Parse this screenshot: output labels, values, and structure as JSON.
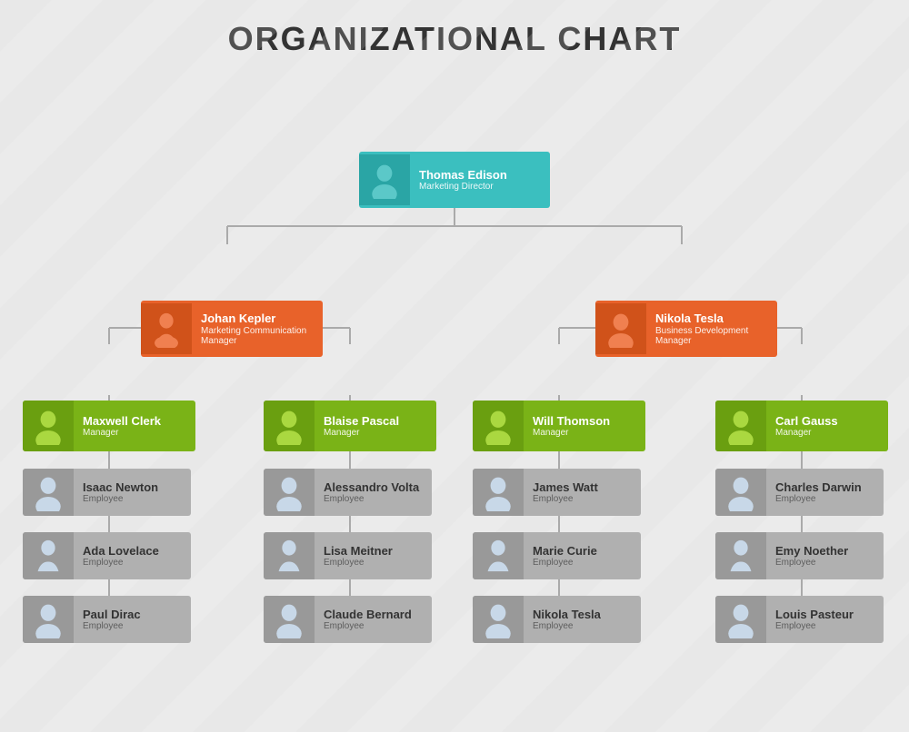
{
  "title": "ORGANIZATIONAL CHART",
  "colors": {
    "teal": "#3bbfbf",
    "teal_dark": "#2aa5a5",
    "orange": "#e8622a",
    "orange_dark": "#d0521a",
    "green": "#7ab317",
    "green_dark": "#6a9f10",
    "gray": "#b0b0b0",
    "gray_dark": "#999999",
    "line": "#aaaaaa"
  },
  "ceo": {
    "name": "Thomas Edison",
    "title": "Marketing Director"
  },
  "l2": [
    {
      "name": "Johan Kepler",
      "title": "Marketing Communication Manager",
      "gender": "f"
    },
    {
      "name": "Nikola Tesla",
      "title": "Business Development Manager",
      "gender": "m"
    }
  ],
  "l3": [
    {
      "name": "Maxwell Clerk",
      "title": "Manager",
      "gender": "m"
    },
    {
      "name": "Blaise Pascal",
      "title": "Manager",
      "gender": "m"
    },
    {
      "name": "Will Thomson",
      "title": "Manager",
      "gender": "m"
    },
    {
      "name": "Carl Gauss",
      "title": "Manager",
      "gender": "m"
    }
  ],
  "l4": [
    [
      {
        "name": "Isaac Newton",
        "title": "Employee",
        "gender": "m"
      },
      {
        "name": "Ada Lovelace",
        "title": "Employee",
        "gender": "f"
      },
      {
        "name": "Paul Dirac",
        "title": "Employee",
        "gender": "m"
      }
    ],
    [
      {
        "name": "Alessandro Volta",
        "title": "Employee",
        "gender": "m"
      },
      {
        "name": "Lisa Meitner",
        "title": "Employee",
        "gender": "f"
      },
      {
        "name": "Claude Bernard",
        "title": "Employee",
        "gender": "m"
      }
    ],
    [
      {
        "name": "James Watt",
        "title": "Employee",
        "gender": "m"
      },
      {
        "name": "Marie Curie",
        "title": "Employee",
        "gender": "f"
      },
      {
        "name": "Nikola Tesla",
        "title": "Employee",
        "gender": "m"
      }
    ],
    [
      {
        "name": "Charles Darwin",
        "title": "Employee",
        "gender": "m"
      },
      {
        "name": "Emy Noether",
        "title": "Employee",
        "gender": "f"
      },
      {
        "name": "Louis Pasteur",
        "title": "Employee",
        "gender": "m"
      }
    ]
  ]
}
